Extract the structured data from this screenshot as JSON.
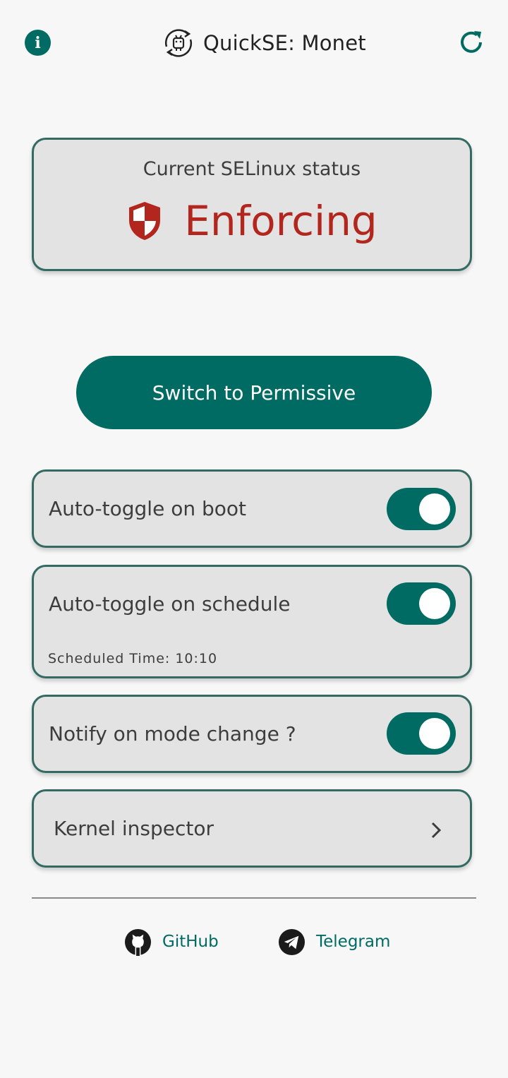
{
  "header": {
    "title": "QuickSE: Monet",
    "info_icon": "info-icon",
    "refresh_icon": "refresh-icon",
    "logo_icon": "android-sync-icon"
  },
  "status_card": {
    "label": "Current SELinux status",
    "value": "Enforcing",
    "icon": "shield-icon"
  },
  "switch_button": {
    "label": "Switch to Permissive"
  },
  "settings": {
    "boot": {
      "label": "Auto-toggle on boot",
      "enabled": true
    },
    "schedule": {
      "label": "Auto-toggle on schedule",
      "enabled": true,
      "time_text": "Scheduled Time: 10:10"
    },
    "notify": {
      "label": "Notify on mode change ?",
      "enabled": true
    },
    "kernel": {
      "label": "Kernel inspector"
    }
  },
  "footer": {
    "github": "GitHub",
    "telegram": "Telegram"
  },
  "colors": {
    "accent": "#006b62",
    "card_bg": "#e3e3e3",
    "card_border": "#336b63",
    "status_red": "#b3261e",
    "page_bg": "#f7f7f7"
  }
}
